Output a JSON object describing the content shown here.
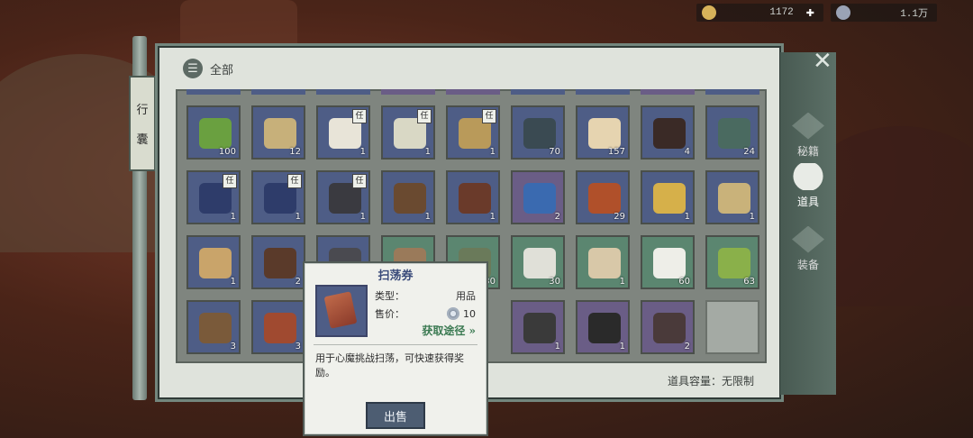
{
  "resources": [
    {
      "icon": "gold-ingot-icon",
      "value": "1172",
      "color": "#d7b25a"
    },
    {
      "icon": "silver-coin-icon",
      "value": "1.1万",
      "color": "#9aa3b5"
    }
  ],
  "side_label": [
    "行",
    "囊"
  ],
  "panel": {
    "filter_label": "全部",
    "capacity_label": "道具容量：无限制"
  },
  "side_tabs": [
    {
      "label": "秘籍",
      "active": false
    },
    {
      "label": "道具",
      "active": true
    },
    {
      "label": "装备",
      "active": false
    }
  ],
  "items": [
    {
      "row": 0,
      "col": 0,
      "color": "blue",
      "count": "100",
      "badge": "",
      "art": "#6aa040",
      "icon": "gourd-bottle-icon"
    },
    {
      "row": 0,
      "col": 1,
      "color": "blue",
      "count": "12",
      "badge": "",
      "art": "#c7b07a",
      "icon": "herb-pouch-icon"
    },
    {
      "row": 0,
      "col": 2,
      "color": "blue",
      "count": "1",
      "badge": "任",
      "art": "#e8e4d8",
      "icon": "bowl-icon"
    },
    {
      "row": 0,
      "col": 3,
      "color": "blue",
      "count": "1",
      "badge": "任",
      "art": "#d9d8c5",
      "icon": "jade-pendant-icon"
    },
    {
      "row": 0,
      "col": 4,
      "color": "blue",
      "count": "1",
      "badge": "任",
      "art": "#b99a5a",
      "icon": "key-icon"
    },
    {
      "row": 0,
      "col": 5,
      "color": "blue",
      "count": "70",
      "badge": "",
      "art": "#3a4a52",
      "icon": "ore-icon"
    },
    {
      "row": 0,
      "col": 6,
      "color": "blue",
      "count": "157",
      "badge": "",
      "art": "#e6d4b0",
      "icon": "cloth-icon"
    },
    {
      "row": 0,
      "col": 7,
      "color": "blue",
      "count": "4",
      "badge": "",
      "art": "#3a2a26",
      "icon": "charcoal-icon"
    },
    {
      "row": 0,
      "col": 8,
      "color": "blue",
      "count": "24",
      "badge": "",
      "art": "#4a6a60",
      "icon": "fabric-roll-icon"
    },
    {
      "row": 1,
      "col": 0,
      "color": "blue",
      "count": "1",
      "badge": "任",
      "art": "#2e3c6a",
      "icon": "book-icon"
    },
    {
      "row": 1,
      "col": 1,
      "color": "blue",
      "count": "1",
      "badge": "任",
      "art": "#2e3c6a",
      "icon": "book-icon"
    },
    {
      "row": 1,
      "col": 2,
      "color": "blue",
      "count": "1",
      "badge": "任",
      "art": "#3a3a40",
      "icon": "book-icon"
    },
    {
      "row": 1,
      "col": 3,
      "color": "blue",
      "count": "1",
      "badge": "",
      "art": "#6a4a30",
      "icon": "scroll-bundle-icon"
    },
    {
      "row": 1,
      "col": 4,
      "color": "blue",
      "count": "1",
      "badge": "",
      "art": "#6a3a2a",
      "icon": "scroll-bundle-icon"
    },
    {
      "row": 1,
      "col": 5,
      "color": "purple",
      "count": "2",
      "badge": "",
      "art": "#3a6ab0",
      "icon": "pearl-icon"
    },
    {
      "row": 1,
      "col": 6,
      "color": "blue",
      "count": "29",
      "badge": "",
      "art": "#b0502a",
      "icon": "spice-pile-icon"
    },
    {
      "row": 1,
      "col": 7,
      "color": "blue",
      "count": "1",
      "badge": "",
      "art": "#d6b04a",
      "icon": "dumpling-plate-icon"
    },
    {
      "row": 1,
      "col": 8,
      "color": "blue",
      "count": "1",
      "badge": "",
      "art": "#c9b27a",
      "icon": "soup-bowl-icon"
    },
    {
      "row": 2,
      "col": 0,
      "color": "blue",
      "count": "1",
      "badge": "",
      "art": "#c9a46a",
      "icon": "fish-plate-icon"
    },
    {
      "row": 2,
      "col": 1,
      "color": "blue",
      "count": "2",
      "badge": "",
      "art": "#5a3a2a",
      "icon": "log-icon"
    },
    {
      "row": 2,
      "col": 2,
      "color": "blue",
      "count": "",
      "badge": "",
      "art": "#4a4a50",
      "icon": "item-icon"
    },
    {
      "row": 2,
      "col": 3,
      "color": "green",
      "count": "",
      "badge": "",
      "art": "#9a7a5a",
      "icon": "item-icon"
    },
    {
      "row": 2,
      "col": 4,
      "color": "green",
      "count": "30",
      "badge": "",
      "art": "#6a7a5a",
      "icon": "item-icon"
    },
    {
      "row": 2,
      "col": 5,
      "color": "green",
      "count": "30",
      "badge": "",
      "art": "#e0e0d8",
      "icon": "tofu-plate-icon"
    },
    {
      "row": 2,
      "col": 6,
      "color": "green",
      "count": "1",
      "badge": "",
      "art": "#d8c8a8",
      "icon": "rice-basket-icon"
    },
    {
      "row": 2,
      "col": 7,
      "color": "green",
      "count": "60",
      "badge": "",
      "art": "#eeeee8",
      "icon": "rice-bowl-icon"
    },
    {
      "row": 2,
      "col": 8,
      "color": "green",
      "count": "63",
      "badge": "",
      "art": "#8ab04a",
      "icon": "zongzi-icon"
    },
    {
      "row": 3,
      "col": 0,
      "color": "blue",
      "count": "3",
      "badge": "",
      "art": "#7a5a3a",
      "icon": "axe-icon"
    },
    {
      "row": 3,
      "col": 1,
      "color": "blue",
      "count": "3",
      "badge": "",
      "art": "#a04a30",
      "icon": "scroll-icon"
    },
    {
      "row": 3,
      "col": 5,
      "color": "purple",
      "count": "1",
      "badge": "",
      "art": "#3a3a3a",
      "icon": "chest-icon"
    },
    {
      "row": 3,
      "col": 6,
      "color": "purple",
      "count": "1",
      "badge": "",
      "art": "#2a2a2a",
      "icon": "chest-icon"
    },
    {
      "row": 3,
      "col": 7,
      "color": "purple",
      "count": "2",
      "badge": "",
      "art": "#4a3a3a",
      "icon": "chest-icon"
    },
    {
      "row": 3,
      "col": 8,
      "color": "empty",
      "count": "",
      "badge": "",
      "art": "",
      "icon": ""
    }
  ],
  "tooltip": {
    "title": "扫荡券",
    "type_label": "类型：",
    "type_value": "用品",
    "price_label": "售价：",
    "price_value": "10",
    "source_link": "获取途径 »",
    "description": "用于心魔挑战扫荡，可快速获得奖励。",
    "sell_button": "出售"
  }
}
